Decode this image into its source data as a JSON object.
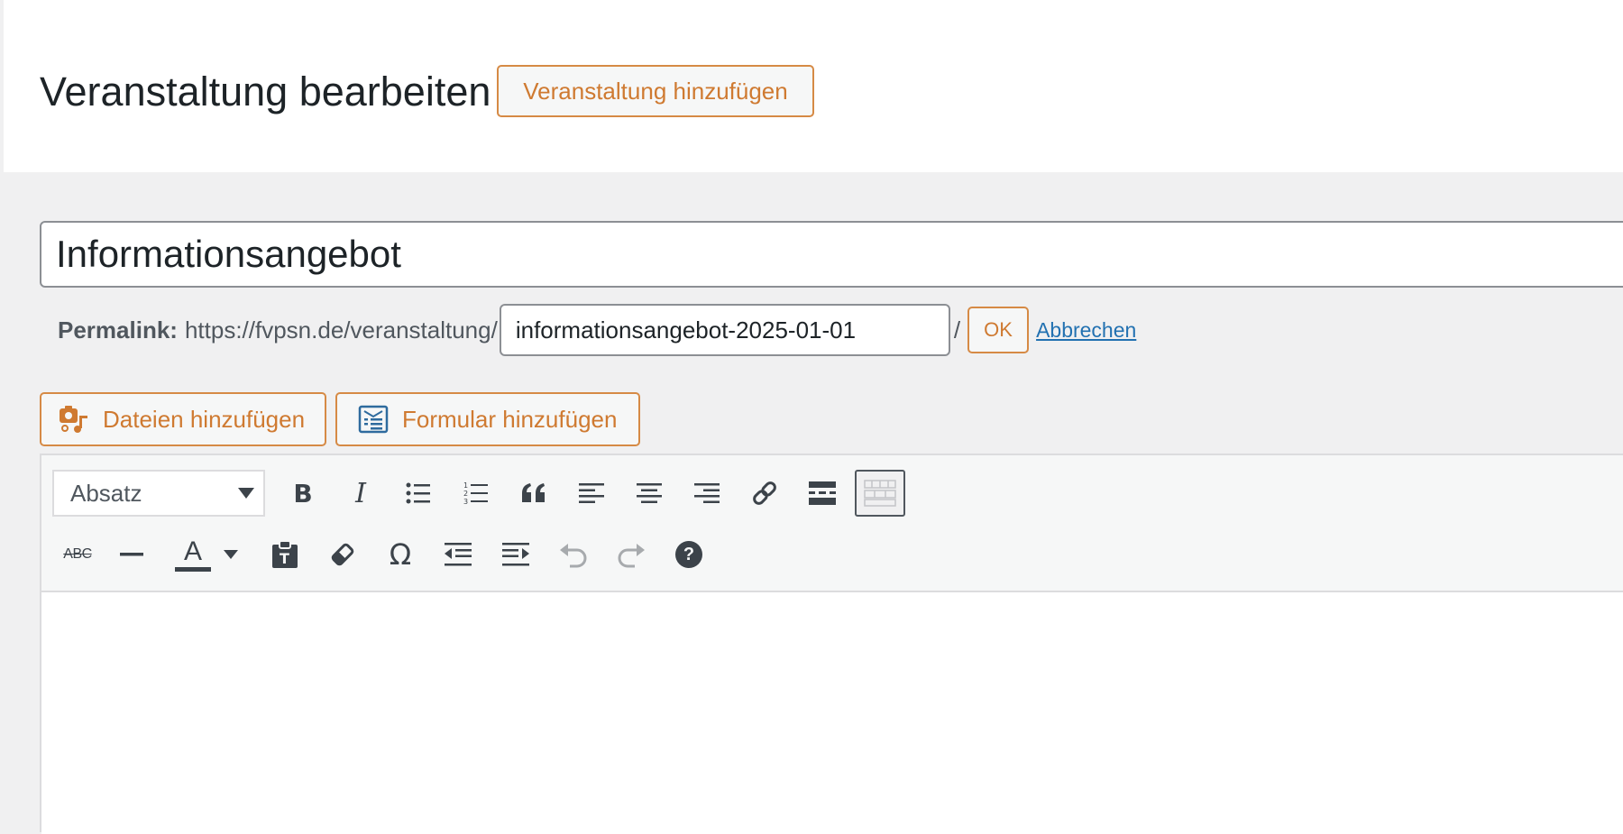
{
  "header": {
    "title": "Veranstaltung bearbeiten",
    "add_new_label": "Veranstaltung hinzufügen"
  },
  "post": {
    "title_value": "Informationsangebot"
  },
  "permalink": {
    "label": "Permalink:",
    "base_url": "https://fvpsn.de/veranstaltung/",
    "slug_value": "informationsangebot-2025-01-01",
    "slash": "/",
    "ok_label": "OK",
    "cancel_label": "Abbrechen"
  },
  "media_buttons": {
    "add_files_label": "Dateien hinzufügen",
    "add_form_label": "Formular hinzufügen"
  },
  "editor": {
    "format_select_value": "Absatz",
    "toolbar_row1_icons": [
      "bold-icon",
      "italic-icon",
      "bulleted-list-icon",
      "numbered-list-icon",
      "blockquote-icon",
      "align-left-icon",
      "align-center-icon",
      "align-right-icon",
      "link-icon",
      "read-more-icon",
      "toolbar-toggle-icon"
    ],
    "toolbar_row2_icons": [
      "strikethrough-icon",
      "horizontal-line-icon",
      "text-color-icon",
      "paste-text-icon",
      "clear-formatting-icon",
      "special-character-icon",
      "outdent-icon",
      "indent-icon",
      "undo-icon",
      "redo-icon",
      "help-icon"
    ],
    "strikethrough_glyph": "ABC",
    "text_color_glyph": "A",
    "bold_glyph": "B",
    "italic_glyph": "I",
    "omega_glyph": "Ω",
    "help_glyph": "?"
  },
  "colors": {
    "accent": "#cf7a31",
    "link": "#2271b1",
    "icon": "#3c434a",
    "disabled_icon": "#a7aaad"
  }
}
